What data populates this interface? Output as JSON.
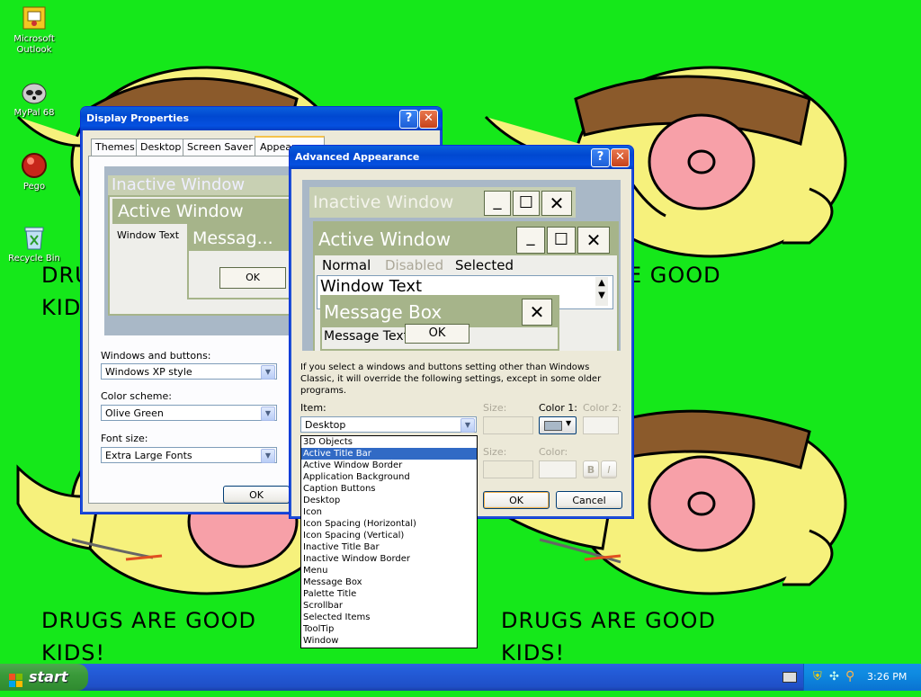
{
  "desktop": {
    "icons": [
      {
        "label": "Microsoft Outlook"
      },
      {
        "label": "MyPal 68"
      },
      {
        "label": "Pego"
      },
      {
        "label": "Recycle Bin"
      }
    ],
    "wallpaper_text": {
      "line1": "DRUGS ARE GOOD",
      "line2": "KIDS!",
      "partial_left_line1": "DRUGS",
      "partial_left_line2": "KID",
      "partial_right": "E GOOD"
    }
  },
  "display_properties": {
    "title": "Display Properties",
    "tabs": [
      "Themes",
      "Desktop",
      "Screen Saver",
      "Appearance"
    ],
    "preview": {
      "inactive": "Inactive Window",
      "active": "Active Window",
      "window_text": "Window Text",
      "message": "Messag...",
      "ok": "OK"
    },
    "windows_buttons_label": "Windows and buttons:",
    "windows_buttons_value": "Windows XP style",
    "color_scheme_label": "Color scheme:",
    "color_scheme_value": "Olive Green",
    "font_size_label": "Font size:",
    "font_size_value": "Extra Large Fonts",
    "ok_label": "OK"
  },
  "advanced_appearance": {
    "title": "Advanced Appearance",
    "preview": {
      "inactive": "Inactive Window",
      "active": "Active Window",
      "normal": "Normal",
      "disabled": "Disabled",
      "selected": "Selected",
      "window_text": "Window Text",
      "message_box": "Message Box",
      "message_text": "Message Text",
      "ok": "OK"
    },
    "info": "If you select a windows and buttons setting other than Windows Classic, it will override the following settings, except in some older programs.",
    "item_label": "Item:",
    "item_value": "Desktop",
    "size_label": "Size:",
    "color1_label": "Color 1:",
    "color2_label": "Color 2:",
    "font_size_label": "Size:",
    "font_color_label": "Color:",
    "bold": "B",
    "italic": "I",
    "ok_label": "OK",
    "cancel_label": "Cancel",
    "items": [
      "3D Objects",
      "Active Title Bar",
      "Active Window Border",
      "Application Background",
      "Caption Buttons",
      "Desktop",
      "Icon",
      "Icon Spacing (Horizontal)",
      "Icon Spacing (Vertical)",
      "Inactive Title Bar",
      "Inactive Window Border",
      "Menu",
      "Message Box",
      "Palette Title",
      "Scrollbar",
      "Selected Items",
      "ToolTip",
      "Window"
    ],
    "selected_item": "Active Title Bar"
  },
  "taskbar": {
    "start": "start",
    "clock": "3:26 PM"
  },
  "colors": {
    "desktop_bg": "#15e81a",
    "xp_blue": "#0a5fdd",
    "olive_active": "#a6b48a",
    "selection": "#316ac5"
  }
}
